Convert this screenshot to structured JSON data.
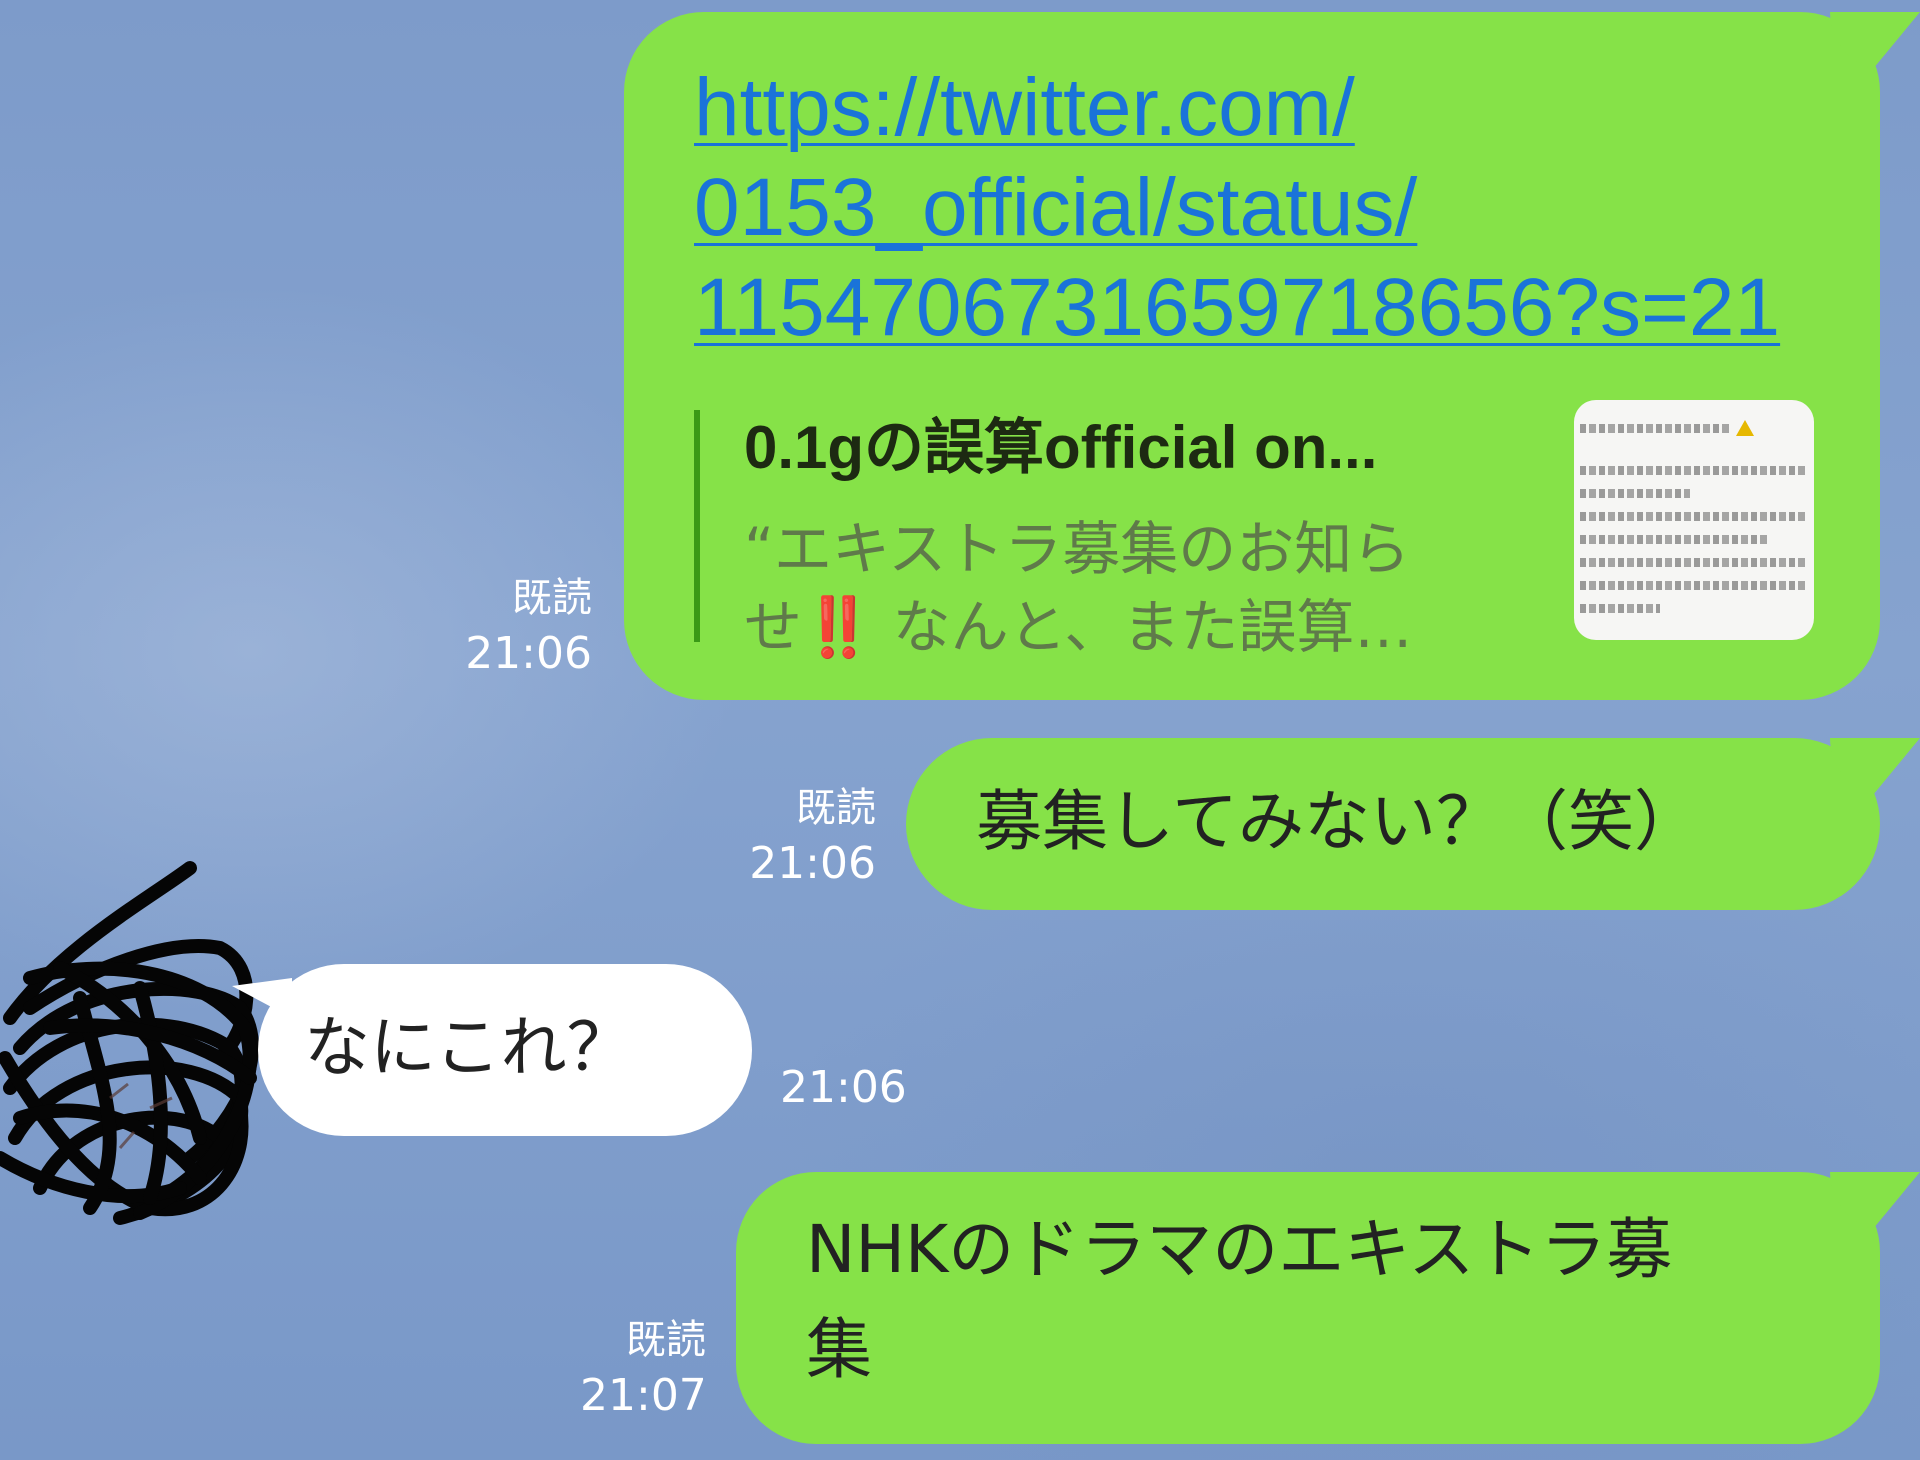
{
  "messages": [
    {
      "id": "m1",
      "side": "outgoing",
      "type": "link",
      "link_lines": [
        "https://twitter.com/",
        "0153_official/status/",
        "1154706731659718656?s=21"
      ],
      "preview": {
        "title": "0.1gの誤算official on...",
        "desc_line1": "“エキストラ募集のお知ら",
        "desc_line2": "せ‼️ なんと、また誤算…"
      },
      "read": "既読",
      "time": "21:06"
    },
    {
      "id": "m2",
      "side": "outgoing",
      "text": "募集してみない？（笑）",
      "read": "既読",
      "time": "21:06"
    },
    {
      "id": "m3",
      "side": "incoming",
      "text": "なにこれ？",
      "time": "21:06"
    },
    {
      "id": "m4",
      "side": "outgoing",
      "text_line1": "NHKのドラマのエキストラ募",
      "text_line2": "集",
      "read": "既読",
      "time": "21:07"
    }
  ],
  "colors": {
    "background": "#7f9dcb",
    "outgoing_bubble": "#86e248",
    "incoming_bubble": "#ffffff",
    "link": "#1a73d9",
    "preview_bar": "#3a9a16"
  },
  "icons": {
    "avatar": "scribbled-out-avatar"
  }
}
